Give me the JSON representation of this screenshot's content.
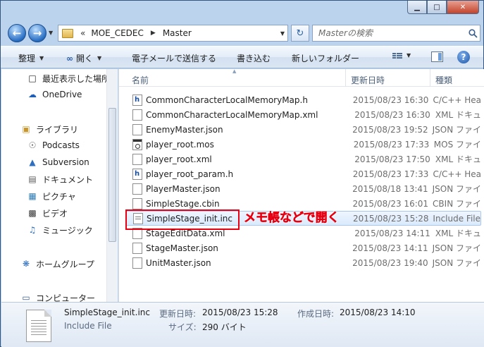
{
  "navigation": {
    "path": [
      "MOE_CEDEC",
      "Master"
    ],
    "search_placeholder": "Masterの検索",
    "overflow_chevron": "«"
  },
  "caption": {
    "minimize": "▁",
    "maximize": "□",
    "close": "✕"
  },
  "toolbar": {
    "organize": "整理",
    "open": "開く",
    "email": "電子メールで送信する",
    "burn": "書き込む",
    "new_folder": "新しいフォルダー",
    "help": "?"
  },
  "sidebar": {
    "items": [
      {
        "label": "最近表示した場所",
        "icon": "recent-places-icon"
      },
      {
        "label": "OneDrive",
        "icon": "onedrive-icon"
      },
      {
        "label": "ライブラリ",
        "icon": "library-icon"
      },
      {
        "label": "Podcasts",
        "icon": "podcast-icon"
      },
      {
        "label": "Subversion",
        "icon": "subversion-icon"
      },
      {
        "label": "ドキュメント",
        "icon": "documents-icon"
      },
      {
        "label": "ピクチャ",
        "icon": "pictures-icon"
      },
      {
        "label": "ビデオ",
        "icon": "video-icon"
      },
      {
        "label": "ミュージック",
        "icon": "music-icon"
      },
      {
        "label": "ホームグループ",
        "icon": "homegroup-icon"
      },
      {
        "label": "コンピューター",
        "icon": "computer-icon"
      }
    ]
  },
  "columns": {
    "name": "名前",
    "modified": "更新日時",
    "type": "種類"
  },
  "files": [
    {
      "name": "CommonCharacterLocalMemoryMap.h",
      "date": "2015/08/23 16:30",
      "type": "C/C++ Hea",
      "icon": "h"
    },
    {
      "name": "CommonCharacterLocalMemoryMap.xml",
      "date": "2015/08/23 16:30",
      "type": "XML ドキュ",
      "icon": "doc"
    },
    {
      "name": "EnemyMaster.json",
      "date": "2015/08/23 19:52",
      "type": "JSON ファイ",
      "icon": "doc"
    },
    {
      "name": "player_root.mos",
      "date": "2015/08/23 17:33",
      "type": "MOS ファイ",
      "icon": "mos"
    },
    {
      "name": "player_root.xml",
      "date": "2015/08/23 17:50",
      "type": "XML ドキュ",
      "icon": "doc"
    },
    {
      "name": "player_root_param.h",
      "date": "2015/08/23 17:33",
      "type": "C/C++ Hea",
      "icon": "h"
    },
    {
      "name": "PlayerMaster.json",
      "date": "2015/08/18 13:41",
      "type": "JSON ファイ",
      "icon": "doc"
    },
    {
      "name": "SimpleStage.cbin",
      "date": "2015/08/23 16:01",
      "type": "CBIN ファイ",
      "icon": "doc"
    },
    {
      "name": "SimpleStage_init.inc",
      "date": "2015/08/23 15:28",
      "type": "Include File",
      "icon": "inc",
      "selected": true
    },
    {
      "name": "StageEditData.xml",
      "date": "2015/08/23 14:11",
      "type": "XML ドキュ",
      "icon": "doc"
    },
    {
      "name": "StageMaster.json",
      "date": "2015/08/23 14:11",
      "type": "JSON ファイ",
      "icon": "doc"
    },
    {
      "name": "UnitMaster.json",
      "date": "2015/08/23 19:40",
      "type": "JSON ファイ",
      "icon": "doc"
    }
  ],
  "annotation": "メモ帳などで開く",
  "annotation_color": "#e60012",
  "details": {
    "filename": "SimpleStage_init.inc",
    "filetype": "Include File",
    "modified_label": "更新日時:",
    "modified_value": "2015/08/23 15:28",
    "created_label": "作成日時:",
    "created_value": "2015/08/23 14:10",
    "size_label": "サイズ:",
    "size_value": "290 バイト"
  }
}
